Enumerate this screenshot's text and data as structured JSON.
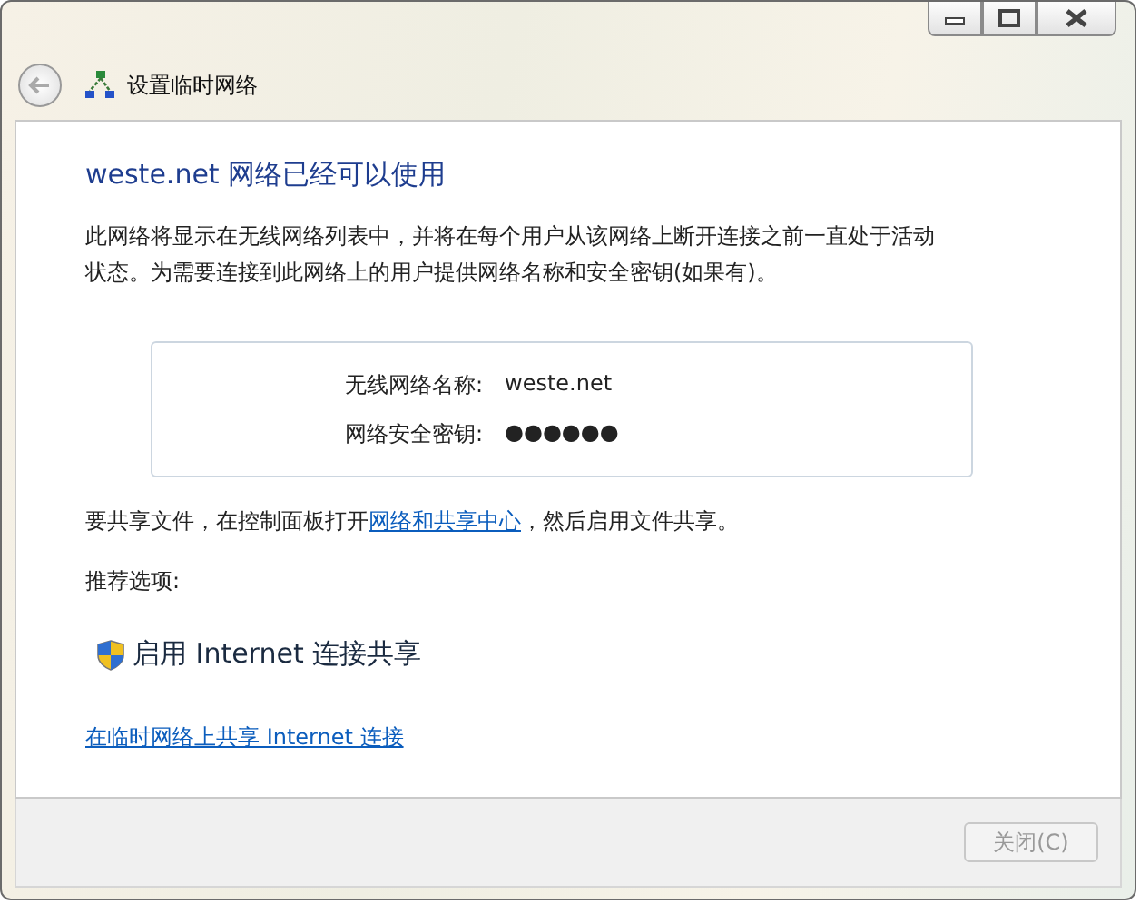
{
  "window": {
    "title": "设置临时网络",
    "controls": [
      {
        "kind": "minimize"
      },
      {
        "kind": "maximize"
      },
      {
        "kind": "close"
      }
    ]
  },
  "heading": "weste.net 网络已经可以使用",
  "description": "此网络将显示在无线网络列表中，并将在每个用户从该网络上断开连接之前一直处于活动状态。为需要连接到此网络上的用户提供网络名称和安全密钥(如果有)。",
  "info": [
    {
      "label": "无线网络名称:",
      "value": "weste.net"
    },
    {
      "label": "网络安全密钥:",
      "value": "●●●●●●"
    }
  ],
  "share_text": {
    "before": "要共享文件，在控制面板打开",
    "link": "网络和共享中心",
    "after": "，然后启用文件共享。"
  },
  "recommended_label": "推荐选项:",
  "option": {
    "label": "启用 Internet 连接共享"
  },
  "bottom_link": "在临时网络上共享 Internet 连接",
  "buttons": [
    {
      "label": "关闭(C)",
      "disabled": true
    }
  ]
}
